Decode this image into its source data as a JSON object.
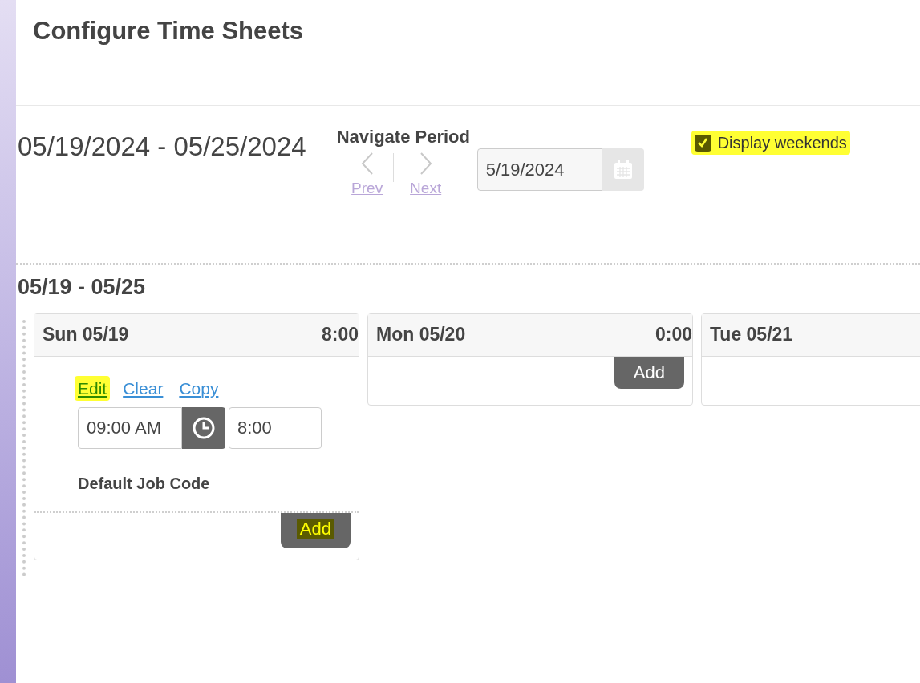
{
  "title": "Configure Time Sheets",
  "period": {
    "range": "05/19/2024 - 05/25/2024",
    "navigate_label": "Navigate Period",
    "prev": {
      "label": "Prev"
    },
    "next": {
      "label": "Next"
    },
    "date": "5/19/2024"
  },
  "display_weekends": {
    "label": "Display weekends",
    "checked": true,
    "highlighted": true
  },
  "week": {
    "label": "05/19 - 05/25",
    "days": [
      {
        "label": "Sun 05/19",
        "total": "8:00",
        "entries": [
          {
            "actions": [
              {
                "label": "Edit",
                "highlighted": true
              },
              {
                "label": "Clear",
                "highlighted": false
              },
              {
                "label": "Copy",
                "highlighted": false
              }
            ],
            "start": "09:00 AM",
            "hours": "8:00",
            "job_code": "Default Job Code"
          }
        ],
        "add": {
          "label": "Add",
          "highlighted": true
        }
      },
      {
        "label": "Mon 05/20",
        "total": "0:00",
        "add": {
          "label": "Add",
          "highlighted": false
        }
      },
      {
        "label": "Tue 05/21"
      }
    ]
  }
}
